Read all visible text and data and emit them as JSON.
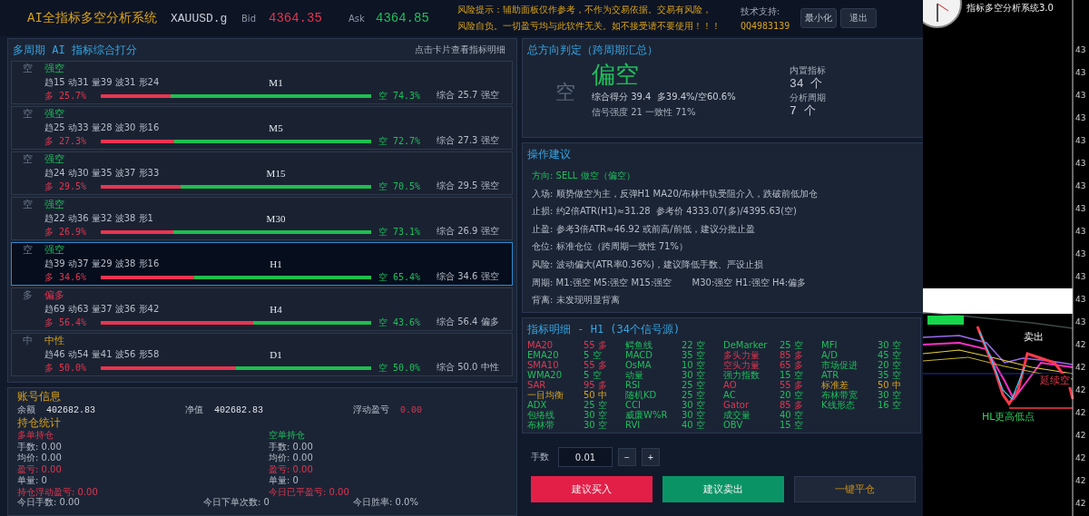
{
  "header": {
    "title": "AI全指标多空分析系统",
    "symbol": "XAUUSD.g",
    "bid_label": "Bid",
    "bid": "4364.35",
    "ask_label": "Ask",
    "ask": "4364.85",
    "risk_lines": [
      "风险提示：辅助面板仅作参考，不作为交易依据。交易有风险，",
      "风险自负。一切盈亏均与此软件无关。如不接受请不要使用！！！"
    ],
    "support_label": "技术支持:",
    "support_contact": "QQ4983139",
    "buttons": [
      "最小化",
      "退出"
    ]
  },
  "periods_panel": {
    "title": "多周期 AI 指标综合打分",
    "hint": "点击卡片查看指标明细",
    "cards": [
      {
        "icon": "空",
        "verdict": "强空",
        "kind": "short",
        "detail": "趋15 动31 量39 波31 形24",
        "period": "M1",
        "long": "多 25.7%",
        "short": "空 74.3%",
        "level": 0.257,
        "summary": "综合 25.7 强空",
        "selected": false
      },
      {
        "icon": "空",
        "verdict": "强空",
        "kind": "short",
        "detail": "趋25 动33 量28 波30 形16",
        "period": "M5",
        "long": "多 27.3%",
        "short": "空 72.7%",
        "level": 0.273,
        "summary": "综合 27.3 强空",
        "selected": false
      },
      {
        "icon": "空",
        "verdict": "强空",
        "kind": "short",
        "detail": "趋24 动30 量35 波37 形33",
        "period": "M15",
        "long": "多 29.5%",
        "short": "空 70.5%",
        "level": 0.295,
        "summary": "综合 29.5 强空",
        "selected": false
      },
      {
        "icon": "空",
        "verdict": "强空",
        "kind": "short",
        "detail": "趋22 动36 量32 波38 形1",
        "period": "M30",
        "long": "多 26.9%",
        "short": "空 73.1%",
        "level": 0.269,
        "summary": "综合 26.9 强空",
        "selected": false
      },
      {
        "icon": "空",
        "verdict": "强空",
        "kind": "short",
        "detail": "趋39 动37 量29 波38 形16",
        "period": "H1",
        "long": "多 34.6%",
        "short": "空 65.4%",
        "level": 0.346,
        "summary": "综合 34.6 强空",
        "selected": true
      },
      {
        "icon": "多",
        "verdict": "偏多",
        "kind": "long",
        "detail": "趋69 动63 量37 波36 形42",
        "period": "H4",
        "long": "多 56.4%",
        "short": "空 43.6%",
        "level": 0.564,
        "summary": "综合 56.4 偏多",
        "selected": false
      },
      {
        "icon": "中",
        "verdict": "中性",
        "kind": "neutral",
        "detail": "趋46 动54 量41 波56 形58",
        "period": "D1",
        "long": "多 50.0%",
        "short": "空 50.0%",
        "level": 0.5,
        "summary": "综合 50.0 中性",
        "selected": false
      }
    ]
  },
  "account": {
    "title": "账号信息",
    "fields": [
      {
        "label": "余额",
        "value": "402682.83",
        "kind": "plain"
      },
      {
        "label": "净值",
        "value": "402682.83",
        "kind": "plain"
      },
      {
        "label": "浮动盈亏",
        "value": "0.00",
        "kind": "pnl"
      }
    ],
    "positions_title": "持仓统计",
    "sides": [
      {
        "title": "多单持仓",
        "kind": "long",
        "lines": [
          {
            "text": "手数: 0.00",
            "kind": "plain"
          },
          {
            "text": "均价: 0.00",
            "kind": "plain"
          },
          {
            "text": "盈亏: 0.00",
            "kind": "pnl"
          },
          {
            "text": "单量: 0",
            "kind": "plain"
          },
          {
            "text": "持仓浮动盈亏: 0.00",
            "kind": "pnl"
          }
        ]
      },
      {
        "title": "空单持仓",
        "kind": "short",
        "lines": [
          {
            "text": "手数: 0.00",
            "kind": "plain"
          },
          {
            "text": "均价: 0.00",
            "kind": "plain"
          },
          {
            "text": "盈亏: 0.00",
            "kind": "pnl"
          },
          {
            "text": "单量: 0",
            "kind": "plain"
          },
          {
            "text": "今日已平盈亏: 0.00",
            "kind": "pnl"
          }
        ]
      }
    ],
    "footer": [
      "今日手数: 0.00",
      "今日下单次数: 0",
      "今日胜率: 0.0%"
    ]
  },
  "summary": {
    "title": "总方向判定（跨周期汇总）",
    "icon": "空",
    "verdict": "偏空",
    "kind": "short",
    "score": "综合得分 39.4  多39.4%/空60.6%",
    "strength": "信号强度 21 一致性 71%",
    "stats": [
      {
        "label": "内置指标",
        "value": "34 个"
      },
      {
        "label": "分析周期",
        "value": "7 个"
      }
    ]
  },
  "advice": {
    "title": "操作建议",
    "lines": [
      {
        "text": "方向: SELL 做空（偏空）",
        "kind": "direction"
      },
      {
        "text": "入场: 顺势做空为主，反弹H1 MA20/布林中轨受阻介入，跌破前低加仓",
        "kind": "plain"
      },
      {
        "text": "止损: 约2倍ATR(H1)≈31.28  参考价 4333.07(多)/4395.63(空)",
        "kind": "plain"
      },
      {
        "text": "止盈: 参考3倍ATR≈46.92 或前高/前低，建议分批止盈",
        "kind": "plain"
      },
      {
        "text": "仓位: 标准仓位（跨周期一致性 71%）",
        "kind": "plain"
      },
      {
        "text": "风险: 波动偏大(ATR率0.36%)，建议降低手数、严设止损",
        "kind": "plain"
      },
      {
        "text": "周期: M1:强空 M5:强空 M15:强空       M30:强空 H1:强空 H4:偏多",
        "kind": "plain"
      },
      {
        "text": "背离: 未发现明显背离",
        "kind": "plain"
      }
    ]
  },
  "indicators": {
    "title": "指标明细 - H1  (34个信号源)",
    "items": [
      {
        "name": "MA20",
        "reading": "55 多",
        "kind": "long"
      },
      {
        "name": "EMA20",
        "reading": "5 空",
        "kind": "short"
      },
      {
        "name": "SMA10",
        "reading": "55 多",
        "kind": "long"
      },
      {
        "name": "WMA20",
        "reading": "5 空",
        "kind": "short"
      },
      {
        "name": "SAR",
        "reading": "95 多",
        "kind": "long"
      },
      {
        "name": "一目均衡",
        "reading": "50 中",
        "kind": "neutral"
      },
      {
        "name": "ADX",
        "reading": "25 空",
        "kind": "short"
      },
      {
        "name": "包络线",
        "reading": "30 空",
        "kind": "short"
      },
      {
        "name": "布林带",
        "reading": "30 空",
        "kind": "short"
      },
      {
        "name": "鳄鱼线",
        "reading": "22 空",
        "kind": "short"
      },
      {
        "name": "MACD",
        "reading": "35 空",
        "kind": "short"
      },
      {
        "name": "OsMA",
        "reading": "10 空",
        "kind": "short"
      },
      {
        "name": "动量",
        "reading": "30 空",
        "kind": "short"
      },
      {
        "name": "RSI",
        "reading": "25 空",
        "kind": "short"
      },
      {
        "name": "随机KD",
        "reading": "25 空",
        "kind": "short"
      },
      {
        "name": "CCI",
        "reading": "30 空",
        "kind": "short"
      },
      {
        "name": "威廉W%R",
        "reading": "30 空",
        "kind": "short"
      },
      {
        "name": "RVI",
        "reading": "40 空",
        "kind": "short"
      },
      {
        "name": "DeMarker",
        "reading": "25 空",
        "kind": "short"
      },
      {
        "name": "多头力量",
        "reading": "85 多",
        "kind": "long"
      },
      {
        "name": "空头力量",
        "reading": "65 多",
        "kind": "long"
      },
      {
        "name": "强力指数",
        "reading": "15 空",
        "kind": "short"
      },
      {
        "name": "AO",
        "reading": "55 多",
        "kind": "long"
      },
      {
        "name": "AC",
        "reading": "20 空",
        "kind": "short"
      },
      {
        "name": "Gator",
        "reading": "85 多",
        "kind": "long"
      },
      {
        "name": "成交量",
        "reading": "40 空",
        "kind": "short"
      },
      {
        "name": "OBV",
        "reading": "15 空",
        "kind": "short"
      },
      {
        "name": "MFI",
        "reading": "30 空",
        "kind": "short"
      },
      {
        "name": "A/D",
        "reading": "45 空",
        "kind": "short"
      },
      {
        "name": "市场促进",
        "reading": "20 空",
        "kind": "short"
      },
      {
        "name": "ATR",
        "reading": "35 空",
        "kind": "short"
      },
      {
        "name": "标准差",
        "reading": "50 中",
        "kind": "neutral"
      },
      {
        "name": "布林带宽",
        "reading": "30 空",
        "kind": "short"
      },
      {
        "name": "K线形态",
        "reading": "16 空",
        "kind": "short"
      }
    ]
  },
  "order": {
    "lot_label": "手数",
    "lot": "0.01",
    "steppers": [
      "−",
      "+"
    ],
    "actions": [
      {
        "label": "建议买入",
        "kind": "buy"
      },
      {
        "label": "建议卖出",
        "kind": "sell"
      },
      {
        "label": "一键平仓",
        "kind": "close"
      }
    ]
  },
  "chart": {
    "title": "指标多空分析系统3.0",
    "labels": [
      {
        "text": "卖出",
        "kind": "sell"
      },
      {
        "text": "延续空",
        "kind": "short"
      },
      {
        "text": "HL更高低点",
        "kind": "note"
      }
    ],
    "axis": [
      "43",
      "43",
      "43",
      "43",
      "43",
      "43",
      "43",
      "43",
      "43",
      "43",
      "43",
      "43",
      "43",
      "42",
      "42",
      "42",
      "42",
      "42",
      "42",
      "42",
      "42"
    ]
  }
}
